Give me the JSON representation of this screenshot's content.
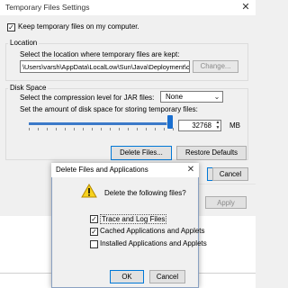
{
  "main_dialog": {
    "title": "Temporary Files Settings",
    "close_glyph": "✕",
    "keep_temp_files": {
      "label": "Keep temporary files on my computer.",
      "checked": true
    },
    "location": {
      "group_title": "Location",
      "caption": "Select the location where temporary files are kept:",
      "path": "\\Users\\varsh\\AppData\\LocalLow\\Sun\\Java\\Deployment\\cache",
      "change_button": "Change..."
    },
    "disk_space": {
      "group_title": "Disk Space",
      "compression_caption": "Select the compression level for JAR files:",
      "compression_value": "None",
      "disk_caption": "Set the amount of disk space for storing temporary files:",
      "disk_value": "32768",
      "disk_unit": "MB",
      "slider_level_percent": 97
    },
    "buttons": {
      "delete_files": "Delete Files...",
      "restore_defaults": "Restore Defaults",
      "cancel": "Cancel"
    }
  },
  "background_panel": {
    "apply_button": "Apply"
  },
  "delete_dialog": {
    "title": "Delete Files and Applications",
    "close_glyph": "✕",
    "question": "Delete the following files?",
    "options": [
      {
        "label": "Trace and Log Files",
        "checked": true
      },
      {
        "label": "Cached Applications and Applets",
        "checked": true
      },
      {
        "label": "Installed Applications and Applets",
        "checked": false
      }
    ],
    "ok_button": "OK",
    "cancel_button": "Cancel"
  },
  "icons": {
    "warning": "warning-icon",
    "close": "close-icon",
    "chevron": "chevron-down-icon",
    "check": "check-icon"
  },
  "colors": {
    "accent": "#0078d7",
    "slider": "#1a6fd0",
    "warning_fill": "#f7d21d"
  }
}
